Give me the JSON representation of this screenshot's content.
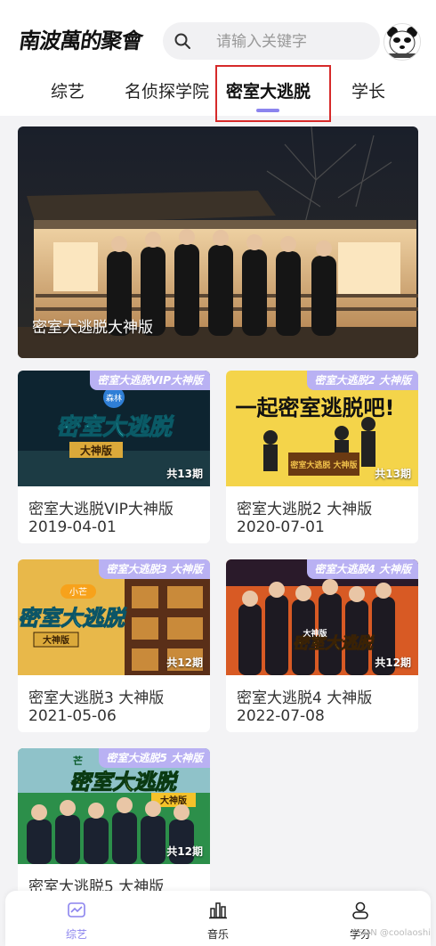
{
  "header": {
    "logo_text": "南波萬的聚會",
    "search_placeholder": "请输入关键字"
  },
  "tabs": [
    {
      "label": "综艺",
      "active": false
    },
    {
      "label": "名侦探学院",
      "active": false
    },
    {
      "label": "密室大逃脱",
      "active": true
    },
    {
      "label": "学长",
      "active": false
    }
  ],
  "banner": {
    "title": "密室大逃脱大神版"
  },
  "cards": [
    {
      "badge": "密室大逃脱VIP大神版",
      "episodes": "共13期",
      "title": "密室大逃脱VIP大神版",
      "date": "2019-04-01",
      "overlay": "密室大逃脱",
      "sub": "大神版",
      "tag": "森林"
    },
    {
      "badge": "密室大逃脱2 大神版",
      "episodes": "共13期",
      "title": "密室大逃脱2 大神版",
      "date": "2020-07-01",
      "overlay": "一起密室逃脱吧!",
      "sub": "密室大逃脱 大神版",
      "tag": ""
    },
    {
      "badge": "密室大逃脱3 大神版",
      "episodes": "共12期",
      "title": "密室大逃脱3 大神版",
      "date": "2021-05-06",
      "overlay": "密室大逃脱",
      "sub": "大神版",
      "tag": "小芒"
    },
    {
      "badge": "密室大逃脱4 大神版",
      "episodes": "共12期",
      "title": "密室大逃脱4 大神版",
      "date": "2022-07-08",
      "overlay": "密室大逃脱",
      "sub": "大神版",
      "tag": ""
    },
    {
      "badge": "密室大逃脱5 大神版",
      "episodes": "共12期",
      "title": "密室大逃脱5 大神版",
      "date": "",
      "overlay": "密室大逃脱",
      "sub": "大神版",
      "tag": "芒"
    }
  ],
  "tabbar": [
    {
      "label": "综艺",
      "icon": "chart-icon",
      "active": true
    },
    {
      "label": "音乐",
      "icon": "bars-icon",
      "active": false
    },
    {
      "label": "学分",
      "icon": "user-icon",
      "active": false
    }
  ],
  "watermark": "CSDN @coolaoshi",
  "colors": {
    "accent": "#8b84ee",
    "badge": "#b9b1f3",
    "highlight": "#d62a2a"
  }
}
